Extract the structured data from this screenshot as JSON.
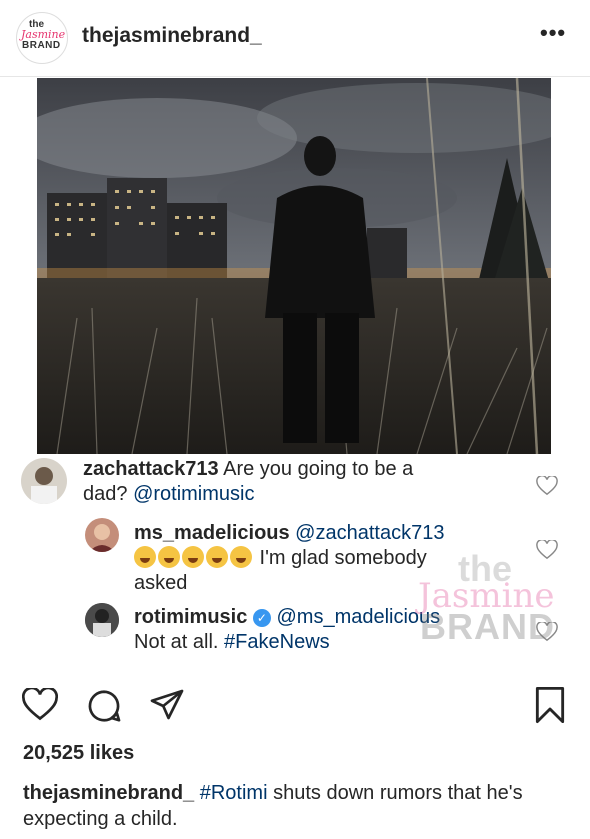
{
  "post": {
    "username": "thejasminebrand_",
    "more_label": "•••",
    "logo": {
      "line1": "the",
      "line2": "Jasmine",
      "line3": "BRAND"
    }
  },
  "comments": [
    {
      "user": "zachattack713",
      "text": " Are you going to be a",
      "text2": "dad? ",
      "mention": "@rotimimusic"
    },
    {
      "user": "ms_madelicious",
      "mention": " @zachattack713",
      "text": " I'm glad somebody",
      "text2": "asked"
    },
    {
      "user": "rotimimusic",
      "mention": " @ms_madelicious",
      "text": "Not at all. ",
      "hashtag": "#FakeNews"
    }
  ],
  "watermark": {
    "line1": "the",
    "line2": "Jasmine",
    "line3": "BRAND"
  },
  "likes": "20,525 likes",
  "caption": {
    "user": "thejasminebrand_",
    "hashtag": "#Rotimi",
    "text": " shuts down rumors that he's expecting a child."
  }
}
